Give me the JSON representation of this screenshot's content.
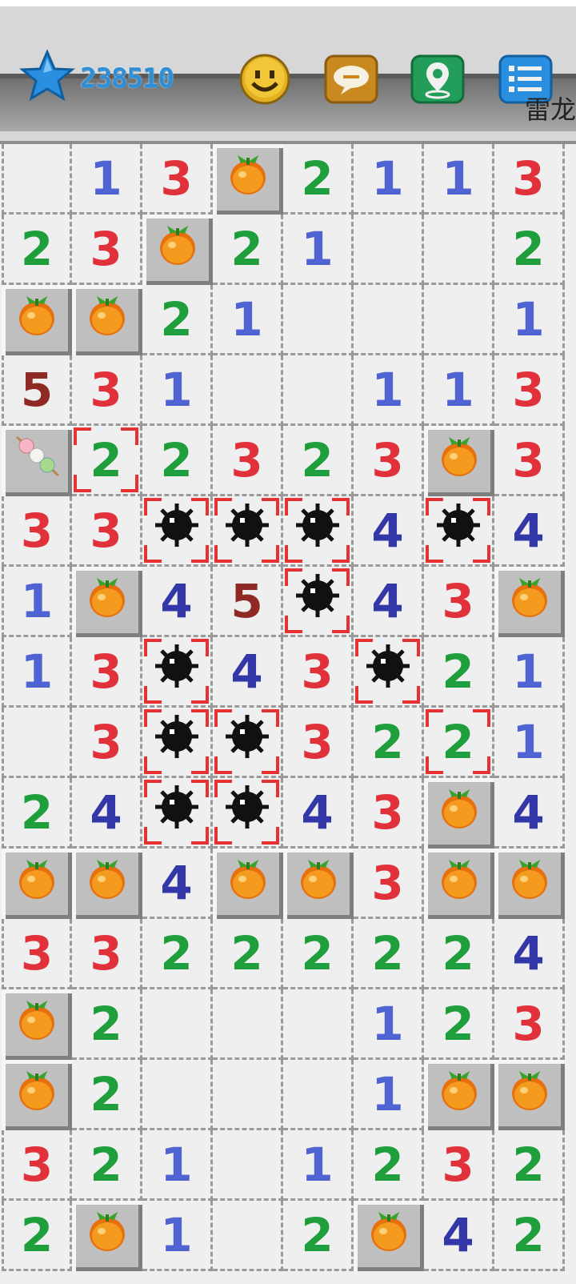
{
  "header": {
    "score": "238510",
    "marquee_text": "雷龙",
    "icons": [
      "star-icon",
      "smiley-face-icon",
      "chat-bubble-icon",
      "location-pin-icon",
      "menu-list-icon"
    ]
  },
  "colors": {
    "num1": "#4f63d2",
    "num2": "#1f9e3c",
    "num3": "#e1323c",
    "num4": "#3437a8",
    "num5": "#8e2a23",
    "highlight": "#e63232"
  },
  "legend": {
    "closed": "unrevealed tile with orange fruit",
    "mine": "revealed black mine",
    "dango": "unrevealed tile with dango skewer",
    "blank": "revealed empty cell"
  },
  "board": [
    [
      "",
      "1",
      "3",
      "C",
      "2",
      "1",
      "1",
      "3"
    ],
    [
      "2",
      "3",
      "C",
      "2",
      "1",
      "",
      "",
      "2"
    ],
    [
      "C",
      "C",
      "2",
      "1",
      "",
      "",
      "",
      "1"
    ],
    [
      "5",
      "3",
      "1",
      "",
      "",
      "1",
      "1",
      "3"
    ],
    [
      "D",
      "2*",
      "2",
      "3",
      "2",
      "3",
      "C",
      "3"
    ],
    [
      "3",
      "3",
      "M",
      "M",
      "M",
      "4",
      "M",
      "4"
    ],
    [
      "1",
      "C",
      "4",
      "5",
      "M",
      "4",
      "3",
      "C"
    ],
    [
      "1",
      "3",
      "M",
      "4",
      "3",
      "M",
      "2",
      "1"
    ],
    [
      "",
      "3",
      "M",
      "M",
      "3",
      "2",
      "2*",
      "1"
    ],
    [
      "2",
      "4",
      "M",
      "M",
      "4",
      "3",
      "C",
      "4"
    ],
    [
      "C",
      "C",
      "4",
      "C",
      "C",
      "3",
      "C",
      "C"
    ],
    [
      "3",
      "3",
      "2",
      "2",
      "2",
      "2",
      "2",
      "4"
    ],
    [
      "C",
      "2",
      "",
      "",
      "",
      "1",
      "2",
      "3"
    ],
    [
      "C",
      "2",
      "",
      "",
      "",
      "1",
      "C",
      "C"
    ],
    [
      "3",
      "2",
      "1",
      "",
      "1",
      "2",
      "3",
      "2"
    ],
    [
      "2",
      "C",
      "1",
      "",
      "2",
      "C",
      "4",
      "2"
    ]
  ]
}
